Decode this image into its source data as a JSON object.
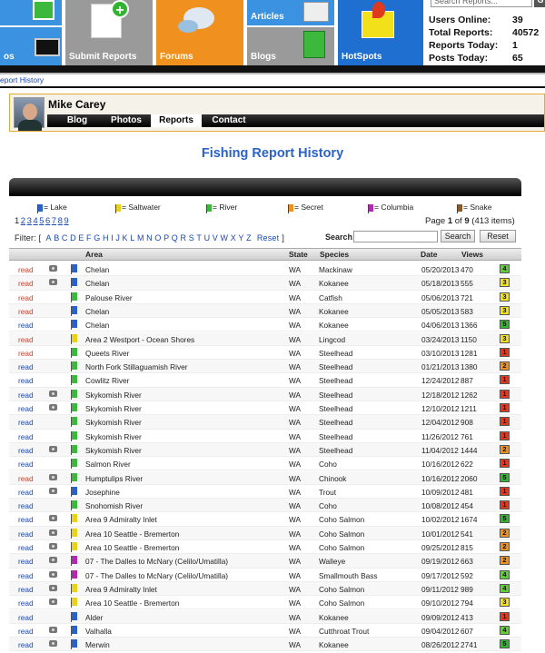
{
  "nav": {
    "tiles": [
      {
        "label": "",
        "color": "#3a92e0"
      },
      {
        "label": "os",
        "color": "#3a92e0"
      },
      {
        "label": "Submit Reports",
        "color": "#9a9a9a"
      },
      {
        "label": "Forums",
        "color": "#f0901e"
      },
      {
        "label": "Articles",
        "color": "#3a92e0"
      },
      {
        "label": "Blogs",
        "color": "#9a9a9a"
      },
      {
        "label": "HotSpots",
        "color": "#1f6fd0"
      }
    ],
    "search_placeholder": "Search Reports...",
    "go_label": "G"
  },
  "stats": [
    {
      "label": "Users Online:",
      "value": "39"
    },
    {
      "label": "Total Reports:",
      "value": "40572"
    },
    {
      "label": "Reports Today:",
      "value": "1"
    },
    {
      "label": "Posts Today:",
      "value": "65"
    }
  ],
  "breadcrumb": "eport History",
  "profile": {
    "name": "Mike Carey",
    "tabs": [
      "Blog",
      "Photos",
      "Reports",
      "Contact"
    ],
    "active_tab": "Reports"
  },
  "page_title": "Fishing Report History",
  "legend": [
    {
      "label": "= Lake",
      "color": "#2a62c8"
    },
    {
      "label": "= Saltwater",
      "color": "#e8d21a"
    },
    {
      "label": "= River",
      "color": "#3cb83c"
    },
    {
      "label": "= Secret",
      "color": "#f0901e"
    },
    {
      "label": "= Columbia",
      "color": "#b02ab0"
    },
    {
      "label": "= Snake",
      "color": "#8a5a2a"
    }
  ],
  "pagination": {
    "pages": [
      "1",
      "2",
      "3",
      "4",
      "5",
      "6",
      "7",
      "8",
      "9"
    ],
    "current": "1",
    "info_prefix": "Page",
    "info_current": "1",
    "info_of": "of",
    "info_total": "9",
    "info_count": "(413 items)"
  },
  "filter": {
    "label": "Filter: [",
    "letters": [
      "A",
      "B",
      "C",
      "D",
      "E",
      "F",
      "G",
      "H",
      "I",
      "J",
      "K",
      "L",
      "M",
      "N",
      "O",
      "P",
      "Q",
      "R",
      "S",
      "T",
      "U",
      "V",
      "W",
      "X",
      "Y",
      "Z"
    ],
    "reset": "Reset",
    "close": "]"
  },
  "search": {
    "label": "Search:",
    "search_button": "Search",
    "reset_button": "Reset"
  },
  "table": {
    "headers": [
      "Area",
      "State",
      "Species",
      "Date",
      "Views"
    ],
    "read_label": "read",
    "rows": [
      {
        "read_color": "orange",
        "cam": true,
        "flag": "#2a62c8",
        "area": "Chelan",
        "state": "WA",
        "species": "Mackinaw",
        "date": "05/20/2013",
        "views": "470",
        "rating": "4",
        "rating_color": "#5ecf33"
      },
      {
        "read_color": "orange",
        "cam": true,
        "flag": "#2a62c8",
        "area": "Chelan",
        "state": "WA",
        "species": "Kokanee",
        "date": "05/18/2013",
        "views": "555",
        "rating": "3",
        "rating_color": "#f2e01a"
      },
      {
        "read_color": "orange",
        "cam": false,
        "flag": "#3cb83c",
        "area": "Palouse River",
        "state": "WA",
        "species": "Catfish",
        "date": "05/06/2013",
        "views": "721",
        "rating": "3",
        "rating_color": "#f2e01a"
      },
      {
        "read_color": "orange",
        "cam": false,
        "flag": "#2a62c8",
        "area": "Chelan",
        "state": "WA",
        "species": "Kokanee",
        "date": "05/05/2013",
        "views": "583",
        "rating": "3",
        "rating_color": "#f2e01a"
      },
      {
        "read_color": "blue",
        "cam": false,
        "flag": "#2a62c8",
        "area": "Chelan",
        "state": "WA",
        "species": "Kokanee",
        "date": "04/06/2013",
        "views": "1366",
        "rating": "5",
        "rating_color": "#2fb52f"
      },
      {
        "read_color": "orange",
        "cam": false,
        "flag": "#e8d21a",
        "area": "Area 2 Westport - Ocean Shores",
        "state": "WA",
        "species": "Lingcod",
        "date": "03/24/2013",
        "views": "1150",
        "rating": "3",
        "rating_color": "#f2e01a"
      },
      {
        "read_color": "orange",
        "cam": false,
        "flag": "#3cb83c",
        "area": "Queets River",
        "state": "WA",
        "species": "Steelhead",
        "date": "03/10/2013",
        "views": "1281",
        "rating": "1",
        "rating_color": "#e03a1e"
      },
      {
        "read_color": "blue",
        "cam": false,
        "flag": "#3cb83c",
        "area": "North Fork Stillaguamish River",
        "state": "WA",
        "species": "Steelhead",
        "date": "01/21/2013",
        "views": "1380",
        "rating": "2",
        "rating_color": "#f0901e"
      },
      {
        "read_color": "blue",
        "cam": false,
        "flag": "#3cb83c",
        "area": "Cowlitz River",
        "state": "WA",
        "species": "Steelhead",
        "date": "12/24/2012",
        "views": "887",
        "rating": "1",
        "rating_color": "#e03a1e"
      },
      {
        "read_color": "blue",
        "cam": true,
        "flag": "#3cb83c",
        "area": "Skykomish River",
        "state": "WA",
        "species": "Steelhead",
        "date": "12/18/2012",
        "views": "1262",
        "rating": "1",
        "rating_color": "#e03a1e"
      },
      {
        "read_color": "blue",
        "cam": true,
        "flag": "#3cb83c",
        "area": "Skykomish River",
        "state": "WA",
        "species": "Steelhead",
        "date": "12/10/2012",
        "views": "1211",
        "rating": "1",
        "rating_color": "#e03a1e"
      },
      {
        "read_color": "blue",
        "cam": false,
        "flag": "#3cb83c",
        "area": "Skykomish River",
        "state": "WA",
        "species": "Steelhead",
        "date": "12/04/2012",
        "views": "908",
        "rating": "1",
        "rating_color": "#e03a1e"
      },
      {
        "read_color": "blue",
        "cam": false,
        "flag": "#3cb83c",
        "area": "Skykomish River",
        "state": "WA",
        "species": "Steelhead",
        "date": "11/26/2012",
        "views": "761",
        "rating": "1",
        "rating_color": "#e03a1e"
      },
      {
        "read_color": "blue",
        "cam": true,
        "flag": "#3cb83c",
        "area": "Skykomish River",
        "state": "WA",
        "species": "Steelhead",
        "date": "11/04/2012",
        "views": "1444",
        "rating": "2",
        "rating_color": "#f0901e"
      },
      {
        "read_color": "blue",
        "cam": false,
        "flag": "#3cb83c",
        "area": "Salmon River",
        "state": "WA",
        "species": "Coho",
        "date": "10/16/2012",
        "views": "622",
        "rating": "1",
        "rating_color": "#e03a1e"
      },
      {
        "read_color": "orange",
        "cam": true,
        "flag": "#3cb83c",
        "area": "Humptulips River",
        "state": "WA",
        "species": "Chinook",
        "date": "10/16/2012",
        "views": "2060",
        "rating": "5",
        "rating_color": "#2fb52f"
      },
      {
        "read_color": "blue",
        "cam": true,
        "flag": "#2a62c8",
        "area": "Josephine",
        "state": "WA",
        "species": "Trout",
        "date": "10/09/2012",
        "views": "481",
        "rating": "1",
        "rating_color": "#e03a1e"
      },
      {
        "read_color": "blue",
        "cam": false,
        "flag": "#3cb83c",
        "area": "Snohomish River",
        "state": "WA",
        "species": "Coho",
        "date": "10/08/2012",
        "views": "454",
        "rating": "1",
        "rating_color": "#e03a1e"
      },
      {
        "read_color": "blue",
        "cam": true,
        "flag": "#e8d21a",
        "area": "Area 9 Admiralty Inlet",
        "state": "WA",
        "species": "Coho Salmon",
        "date": "10/02/2012",
        "views": "1674",
        "rating": "5",
        "rating_color": "#2fb52f"
      },
      {
        "read_color": "blue",
        "cam": true,
        "flag": "#e8d21a",
        "area": "Area 10 Seattle - Bremerton",
        "state": "WA",
        "species": "Coho Salmon",
        "date": "10/01/2012",
        "views": "541",
        "rating": "2",
        "rating_color": "#f0901e"
      },
      {
        "read_color": "blue",
        "cam": true,
        "flag": "#e8d21a",
        "area": "Area 10 Seattle - Bremerton",
        "state": "WA",
        "species": "Coho Salmon",
        "date": "09/25/2012",
        "views": "815",
        "rating": "2",
        "rating_color": "#f0901e"
      },
      {
        "read_color": "blue",
        "cam": true,
        "flag": "#b02ab0",
        "area": "07 - The Dalles to McNary (Celilo/Umatilla)",
        "state": "WA",
        "species": "Walleye",
        "date": "09/19/2012",
        "views": "663",
        "rating": "2",
        "rating_color": "#f0901e"
      },
      {
        "read_color": "blue",
        "cam": true,
        "flag": "#b02ab0",
        "area": "07 - The Dalles to McNary (Celilo/Umatilla)",
        "state": "WA",
        "species": "Smallmouth Bass",
        "date": "09/17/2012",
        "views": "592",
        "rating": "4",
        "rating_color": "#5ecf33"
      },
      {
        "read_color": "blue",
        "cam": true,
        "flag": "#e8d21a",
        "area": "Area 9 Admiralty Inlet",
        "state": "WA",
        "species": "Coho Salmon",
        "date": "09/11/2012",
        "views": "989",
        "rating": "4",
        "rating_color": "#5ecf33"
      },
      {
        "read_color": "blue",
        "cam": true,
        "flag": "#e8d21a",
        "area": "Area 10 Seattle - Bremerton",
        "state": "WA",
        "species": "Coho Salmon",
        "date": "09/10/2012",
        "views": "794",
        "rating": "3",
        "rating_color": "#f2e01a"
      },
      {
        "read_color": "blue",
        "cam": false,
        "flag": "#2a62c8",
        "area": "Alder",
        "state": "WA",
        "species": "Kokanee",
        "date": "09/09/2012",
        "views": "413",
        "rating": "1",
        "rating_color": "#e03a1e"
      },
      {
        "read_color": "blue",
        "cam": true,
        "flag": "#2a62c8",
        "area": "Valhalla",
        "state": "WA",
        "species": "Cutthroat Trout",
        "date": "09/04/2012",
        "views": "607",
        "rating": "4",
        "rating_color": "#5ecf33"
      },
      {
        "read_color": "blue",
        "cam": true,
        "flag": "#2a62c8",
        "area": "Merwin",
        "state": "WA",
        "species": "Kokanee",
        "date": "08/26/2012",
        "views": "2741",
        "rating": "5",
        "rating_color": "#2fb52f"
      }
    ]
  }
}
